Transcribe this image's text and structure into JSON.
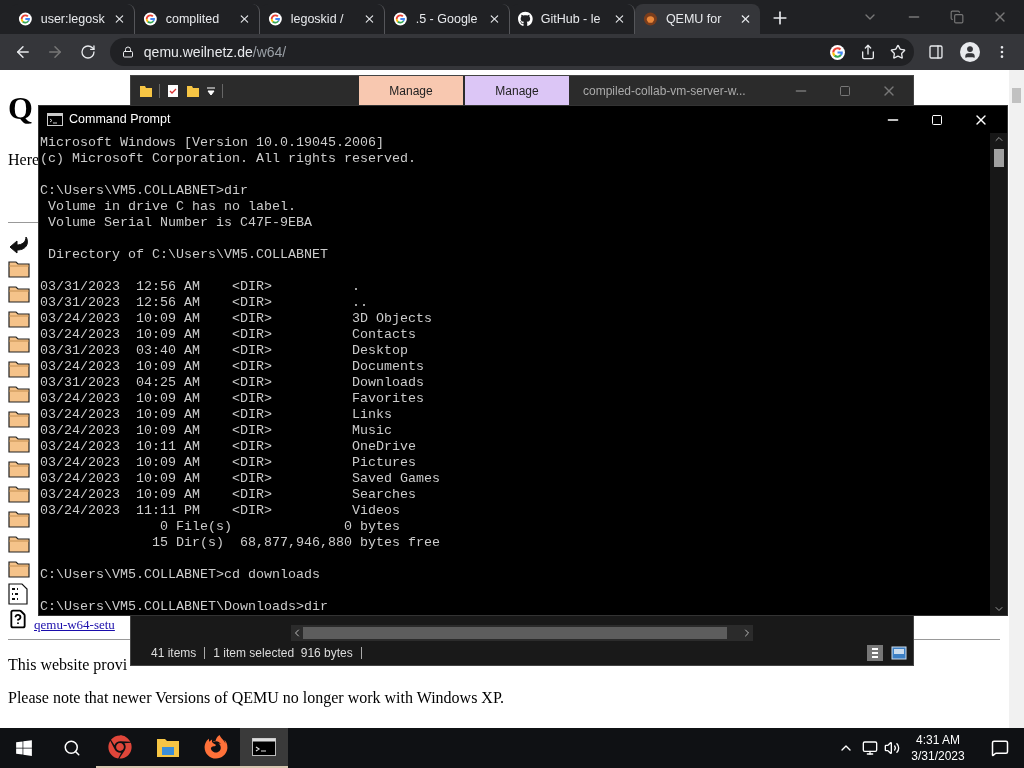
{
  "browser": {
    "tabs": [
      {
        "title": "user:legosk",
        "kind": "google",
        "selected": false
      },
      {
        "title": "complited",
        "kind": "google",
        "selected": false
      },
      {
        "title": "legoskid / ",
        "kind": "google",
        "selected": false
      },
      {
        "title": ".5 - Google",
        "kind": "google",
        "selected": false
      },
      {
        "title": "GitHub - le",
        "kind": "github",
        "selected": false
      },
      {
        "title": "QEMU for",
        "kind": "qemu",
        "selected": true
      }
    ],
    "url_host": "qemu.weilnetz.de",
    "url_path": "/w64/"
  },
  "page": {
    "heading": "Q",
    "intro": "Here",
    "listing": [
      {
        "kind": "back"
      },
      {
        "kind": "folder"
      },
      {
        "kind": "folder"
      },
      {
        "kind": "folder"
      },
      {
        "kind": "folder"
      },
      {
        "kind": "folder"
      },
      {
        "kind": "folder"
      },
      {
        "kind": "folder"
      },
      {
        "kind": "folder"
      },
      {
        "kind": "folder"
      },
      {
        "kind": "folder"
      },
      {
        "kind": "folder"
      },
      {
        "kind": "folder"
      },
      {
        "kind": "folder"
      },
      {
        "kind": "binary"
      },
      {
        "kind": "help",
        "link": "qemu-w64-setu"
      }
    ],
    "paragraphs": [
      "This website provi",
      "Please note that newer Versions of QEMU no longer work with Windows XP."
    ]
  },
  "explorer": {
    "ribbon_tabs": [
      {
        "label": "Manage",
        "color": "#f8c8b0"
      },
      {
        "label": "Manage",
        "color": "#dcc6f6"
      }
    ],
    "title": "compiled-collab-vm-server-w...",
    "status": [
      "41 items",
      "1 item selected  916 bytes"
    ]
  },
  "cmd": {
    "title": "Command Prompt",
    "blocks": [
      [
        "Microsoft Windows [Version 10.0.19045.2006]",
        "(c) Microsoft Corporation. All rights reserved."
      ],
      [
        "C:\\Users\\VM5.COLLABNET>dir",
        " Volume in drive C has no label.",
        " Volume Serial Number is C47F-9EBA"
      ],
      [
        " Directory of C:\\Users\\VM5.COLLABNET"
      ],
      [
        "03/31/2023  12:56 AM    <DIR>          .",
        "03/31/2023  12:56 AM    <DIR>          ..",
        "03/24/2023  10:09 AM    <DIR>          3D Objects",
        "03/24/2023  10:09 AM    <DIR>          Contacts",
        "03/31/2023  03:40 AM    <DIR>          Desktop",
        "03/24/2023  10:09 AM    <DIR>          Documents",
        "03/31/2023  04:25 AM    <DIR>          Downloads",
        "03/24/2023  10:09 AM    <DIR>          Favorites",
        "03/24/2023  10:09 AM    <DIR>          Links",
        "03/24/2023  10:09 AM    <DIR>          Music",
        "03/24/2023  10:11 AM    <DIR>          OneDrive",
        "03/24/2023  10:09 AM    <DIR>          Pictures",
        "03/24/2023  10:09 AM    <DIR>          Saved Games",
        "03/24/2023  10:09 AM    <DIR>          Searches",
        "03/24/2023  11:11 PM    <DIR>          Videos",
        "               0 File(s)              0 bytes",
        "              15 Dir(s)  68,877,946,880 bytes free"
      ],
      [
        "C:\\Users\\VM5.COLLABNET>cd downloads"
      ],
      [
        "C:\\Users\\VM5.COLLABNET\\Downloads>dir"
      ]
    ]
  },
  "taskbar": {
    "apps": [
      {
        "kind": "chrome",
        "selected": false
      },
      {
        "kind": "files",
        "selected": false
      },
      {
        "kind": "firefox",
        "selected": false
      },
      {
        "kind": "terminal",
        "selected": true
      }
    ],
    "time": "4:31 AM",
    "date": "3/31/2023"
  }
}
